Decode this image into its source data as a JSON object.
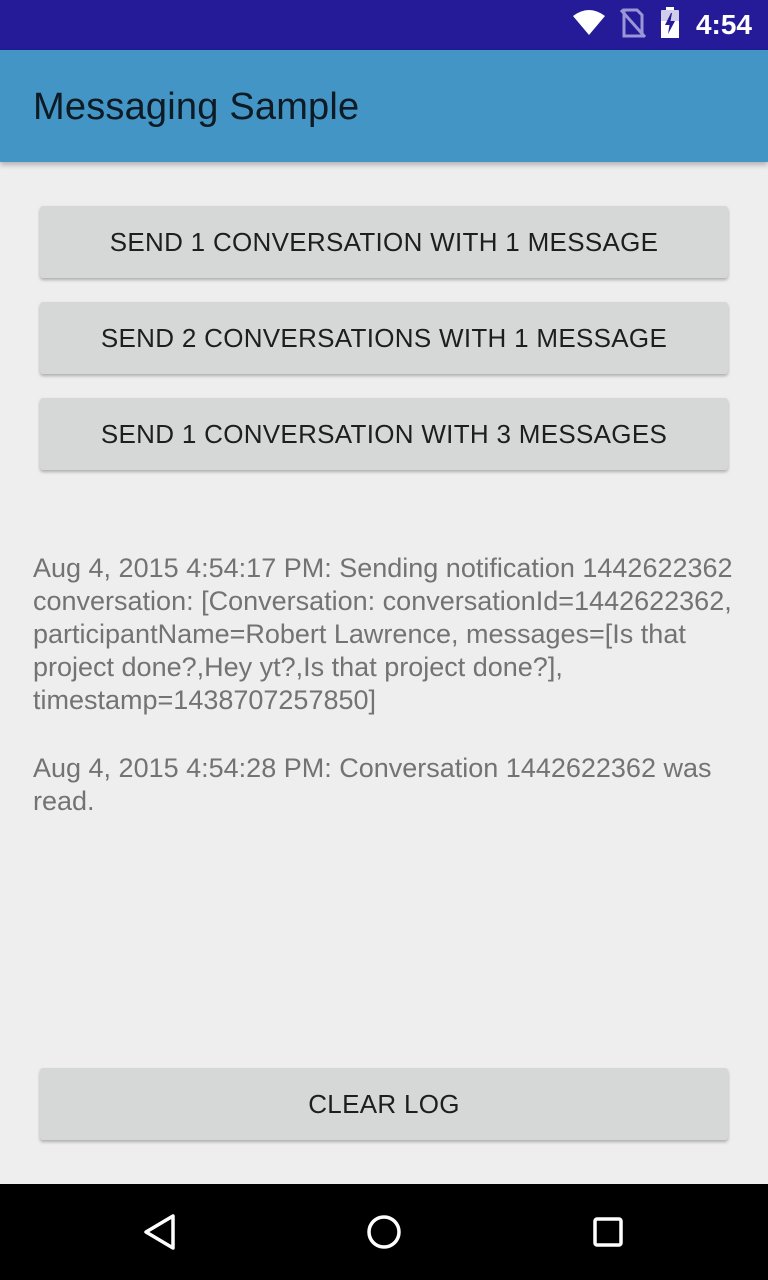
{
  "status_bar": {
    "time": "4:54",
    "icons": [
      "wifi-icon",
      "no-sim-icon",
      "battery-charging-icon"
    ]
  },
  "app_bar": {
    "title": "Messaging Sample"
  },
  "buttons": {
    "send_one_one": "SEND 1 CONVERSATION WITH 1 MESSAGE",
    "send_two_one": "SEND 2 CONVERSATIONS WITH 1 MESSAGE",
    "send_one_three": "SEND 1 CONVERSATION WITH 3 MESSAGES",
    "clear_log": "CLEAR LOG"
  },
  "log": {
    "entries": [
      "Aug 4, 2015 4:54:17 PM: Sending notification 1442622362 conversation: [Conversation: conversationId=1442622362, participantName=Robert Lawrence, messages=[Is that project done?,Hey yt?,Is that project done?], timestamp=1438707257850]",
      "Aug 4, 2015 4:54:28 PM: Conversation 1442622362 was read."
    ]
  },
  "nav_bar": {
    "icons": [
      "back-icon",
      "home-icon",
      "recents-icon"
    ]
  },
  "colors": {
    "status_bar": "#251a98",
    "app_bar": "#4295c4",
    "background": "#eeeeee",
    "button": "#d6d7d7",
    "log_text": "#737373",
    "nav_bar": "#000000"
  }
}
